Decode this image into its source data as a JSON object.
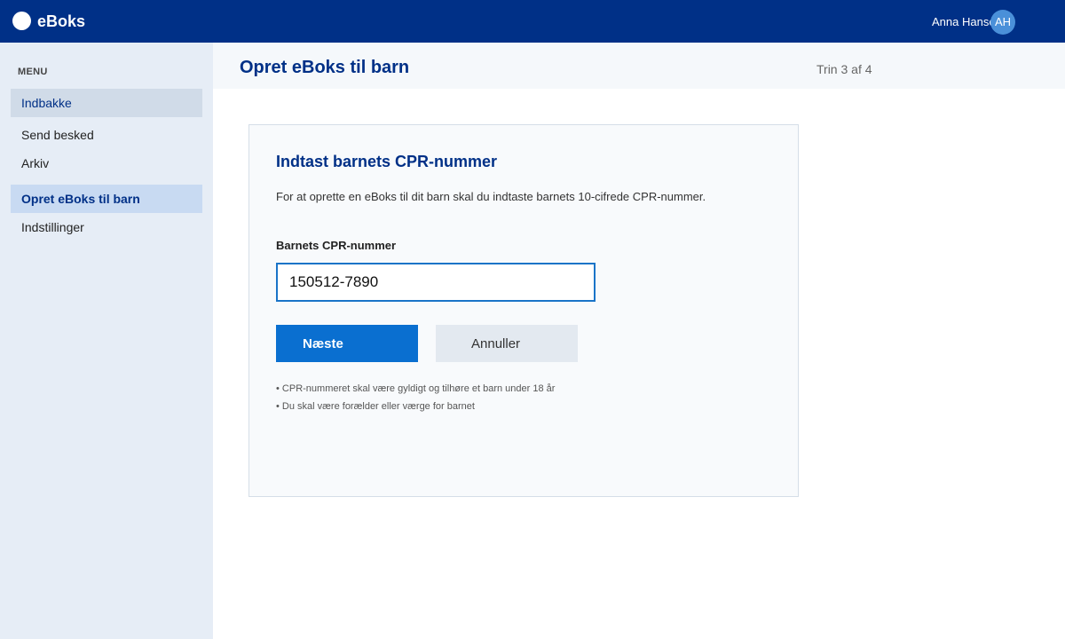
{
  "header": {
    "brand": "eBoks",
    "user_name": "Anna Hansen",
    "avatar_initials": "AH"
  },
  "sidebar": {
    "heading": "MENU",
    "items": [
      {
        "label": "Indbakke"
      },
      {
        "label": "Send besked"
      },
      {
        "label": "Arkiv"
      },
      {
        "label": "Opret eBoks til barn"
      },
      {
        "label": "Indstillinger"
      }
    ]
  },
  "page": {
    "title": "Opret eBoks til barn",
    "step": "Trin 3 af 4"
  },
  "form": {
    "title": "Indtast barnets CPR-nummer",
    "description": "For at oprette en eBoks til dit barn skal du indtaste barnets 10-cifrede CPR-nummer.",
    "field_label": "Barnets CPR-nummer",
    "cpr_value": "150512-7890",
    "next_label": "Næste",
    "cancel_label": "Annuller",
    "notes": [
      "• CPR-nummeret skal være gyldigt og tilhøre et barn under 18 år",
      "• Du skal være forælder eller værge for barnet"
    ]
  },
  "colors": {
    "primary": "#003087",
    "accent": "#0a6fd0"
  }
}
